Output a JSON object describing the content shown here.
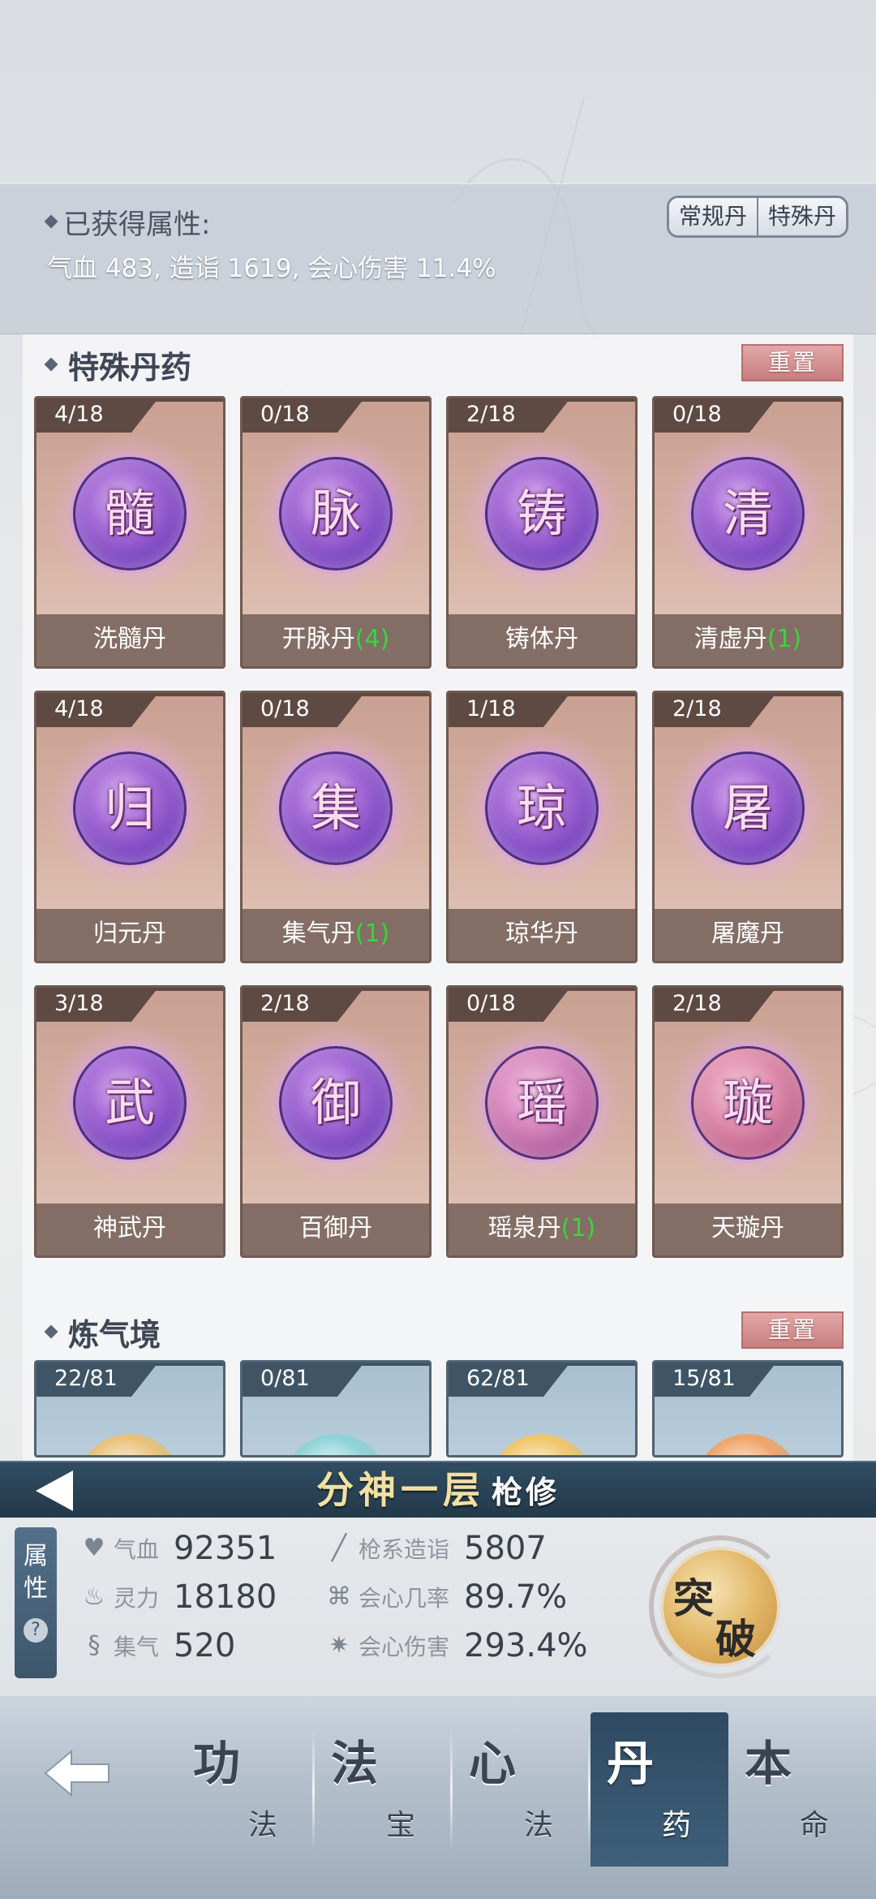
{
  "summary": {
    "title": "已获得属性:",
    "values": "气血 483, 造诣 1619, 会心伤害 11.4%",
    "toggle": [
      "常规丹",
      "特殊丹"
    ]
  },
  "special_section": {
    "title": "特殊丹药",
    "reset_label": "重置",
    "cards": [
      {
        "count": "4/18",
        "glyph": "髓",
        "name": "洗髓丹",
        "bonus": "",
        "color": "purple"
      },
      {
        "count": "0/18",
        "glyph": "脉",
        "name": "开脉丹",
        "bonus": "(4)",
        "color": "purple"
      },
      {
        "count": "2/18",
        "glyph": "铸",
        "name": "铸体丹",
        "bonus": "",
        "color": "purple"
      },
      {
        "count": "0/18",
        "glyph": "清",
        "name": "清虚丹",
        "bonus": "(1)",
        "color": "purple"
      },
      {
        "count": "4/18",
        "glyph": "归",
        "name": "归元丹",
        "bonus": "",
        "color": "purple"
      },
      {
        "count": "0/18",
        "glyph": "集",
        "name": "集气丹",
        "bonus": "(1)",
        "color": "purple"
      },
      {
        "count": "1/18",
        "glyph": "琼",
        "name": "琼华丹",
        "bonus": "",
        "color": "purple"
      },
      {
        "count": "2/18",
        "glyph": "屠",
        "name": "屠魔丹",
        "bonus": "",
        "color": "purple"
      },
      {
        "count": "3/18",
        "glyph": "武",
        "name": "神武丹",
        "bonus": "",
        "color": "purple"
      },
      {
        "count": "2/18",
        "glyph": "御",
        "name": "百御丹",
        "bonus": "",
        "color": "purple"
      },
      {
        "count": "0/18",
        "glyph": "瑶",
        "name": "瑶泉丹",
        "bonus": "(1)",
        "color": "pink"
      },
      {
        "count": "2/18",
        "glyph": "璇",
        "name": "天璇丹",
        "bonus": "",
        "color": "pinkred"
      }
    ]
  },
  "qi_section": {
    "title": "炼气境",
    "reset_label": "重置",
    "cards": [
      {
        "count": "22/81",
        "orb": "#e9c27a"
      },
      {
        "count": "0/81",
        "orb": "#8fd3d8"
      },
      {
        "count": "62/81",
        "orb": "#f0c76a"
      },
      {
        "count": "15/81",
        "orb": "#f0a56a"
      }
    ]
  },
  "realm": {
    "stage": "分神一层",
    "job": "枪修"
  },
  "stats": {
    "side_label": [
      "属",
      "性"
    ],
    "help": "?",
    "items": [
      {
        "icon": "heart-icon",
        "glyph": "♥",
        "label": "气血",
        "value": "92351"
      },
      {
        "icon": "spear-icon",
        "glyph": "╱",
        "label": "枪系造诣",
        "value": "5807"
      },
      {
        "icon": "flame-icon",
        "glyph": "♨",
        "label": "灵力",
        "value": "18180"
      },
      {
        "icon": "crit-rate-icon",
        "glyph": "⌘",
        "label": "会心几率",
        "value": "89.7%"
      },
      {
        "icon": "swirl-icon",
        "glyph": "§",
        "label": "集气",
        "value": "520"
      },
      {
        "icon": "crit-damage-icon",
        "glyph": "✷",
        "label": "会心伤害",
        "value": "293.4%"
      }
    ],
    "breakthrough": [
      "突",
      "破"
    ]
  },
  "nav": {
    "tabs": [
      {
        "big": "功",
        "small": "法",
        "active": false
      },
      {
        "big": "法",
        "small": "宝",
        "active": false
      },
      {
        "big": "心",
        "small": "法",
        "active": false
      },
      {
        "big": "丹",
        "small": "药",
        "active": true
      },
      {
        "big": "本",
        "small": "命",
        "active": false
      }
    ]
  }
}
